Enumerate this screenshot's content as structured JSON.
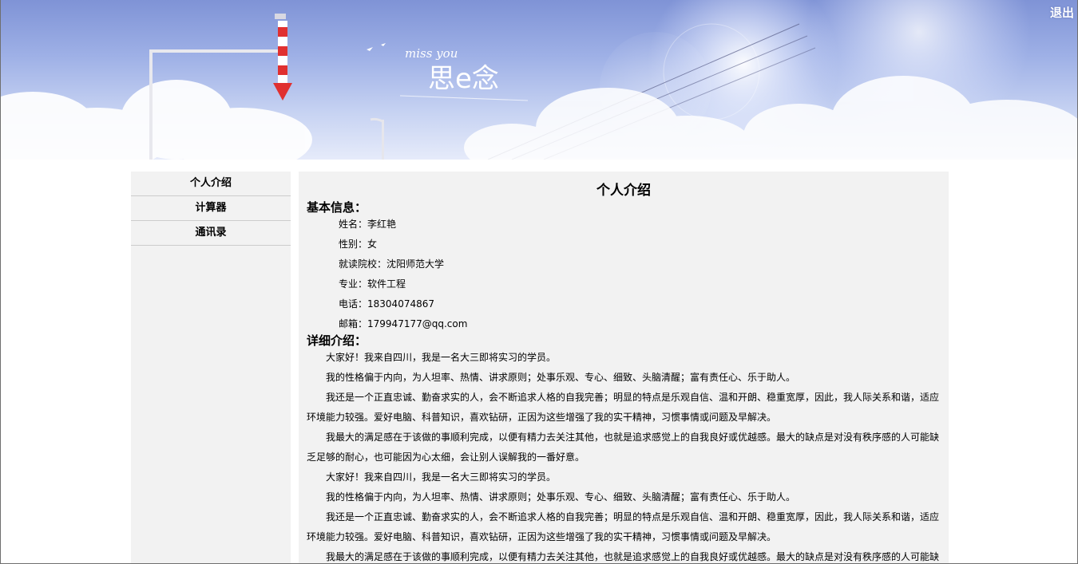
{
  "header": {
    "logout_label": "退出",
    "banner_text_script": "miss you",
    "banner_text_main": "思e念"
  },
  "sidebar": {
    "items": [
      {
        "label": "个人介绍"
      },
      {
        "label": "计算器"
      },
      {
        "label": "通讯录"
      }
    ]
  },
  "main": {
    "title": "个人介绍",
    "basic_heading": "基本信息：",
    "basic_info": [
      {
        "label": "姓名：",
        "value": "李红艳"
      },
      {
        "label": "性别：",
        "value": "女"
      },
      {
        "label": "就读院校：",
        "value": "沈阳师范大学"
      },
      {
        "label": "专业：",
        "value": "软件工程"
      },
      {
        "label": "电话：",
        "value": "18304074867"
      },
      {
        "label": "邮箱：",
        "value": "179947177@qq.com"
      }
    ],
    "detail_heading": "详细介绍：",
    "paragraphs": [
      "大家好！我来自四川，我是一名大三即将实习的学员。",
      "我的性格偏于内向，为人坦率、热情、讲求原则；处事乐观、专心、细致、头脑清醒；富有责任心、乐于助人。",
      "我还是一个正直忠诚、勤奋求实的人，会不断追求人格的自我完善；明显的特点是乐观自信、温和开朗、稳重宽厚，因此，我人际关系和谐，适应环境能力较强。爱好电脑、科普知识，喜欢钻研，正因为这些增强了我的实干精神，习惯事情或问题及早解决。",
      "我最大的满足感在于该做的事顺利完成，以便有精力去关注其他，也就是追求感觉上的自我良好或优越感。最大的缺点是对没有秩序感的人可能缺乏足够的耐心，也可能因为心太细，会让别人误解我的一番好意。",
      "大家好！我来自四川，我是一名大三即将实习的学员。",
      "我的性格偏于内向，为人坦率、热情、讲求原则；处事乐观、专心、细致、头脑清醒；富有责任心、乐于助人。",
      "我还是一个正直忠诚、勤奋求实的人，会不断追求人格的自我完善；明显的特点是乐观自信、温和开朗、稳重宽厚，因此，我人际关系和谐，适应环境能力较强。爱好电脑、科普知识，喜欢钻研，正因为这些增强了我的实干精神，习惯事情或问题及早解决。",
      "我最大的满足感在于该做的事顺利完成，以便有精力去关注其他，也就是追求感觉上的自我良好或优越感。最大的缺点是对没有秩序感的人可能缺乏足够的耐心，也可能因为心太细，会让别人误解我的一番好意。"
    ]
  }
}
